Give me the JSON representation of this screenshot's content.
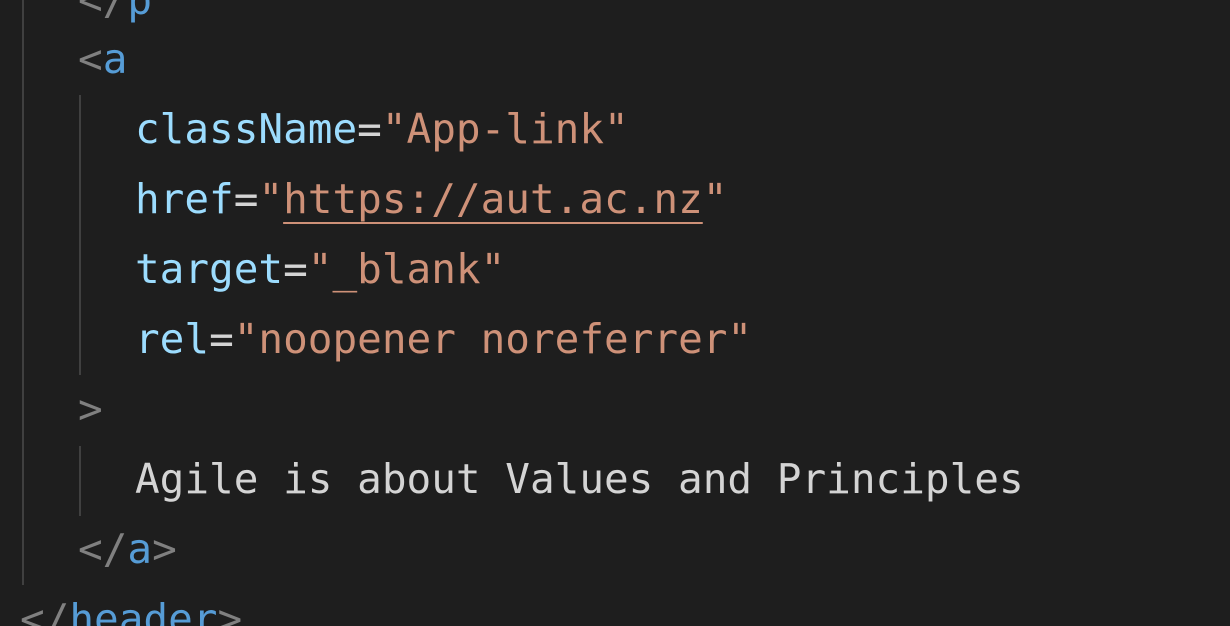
{
  "editor": {
    "lines": {
      "p_close_fragment": {
        "open": "</",
        "tag": "p"
      },
      "a_open": {
        "open": "<",
        "tag": "a"
      },
      "classname": {
        "attr": "className",
        "eq": "=",
        "value": "\"App-link\""
      },
      "href": {
        "attr": "href",
        "eq": "=",
        "quote_open": "\"",
        "url": "https://aut.ac.nz",
        "quote_close": "\""
      },
      "target": {
        "attr": "target",
        "eq": "=",
        "value": "\"_blank\""
      },
      "rel": {
        "attr": "rel",
        "eq": "=",
        "value": "\"noopener noreferrer\""
      },
      "a_open_close": {
        "close": ">"
      },
      "content": {
        "text": "Agile is about Values and Principles"
      },
      "a_close": {
        "open": "</",
        "tag": "a",
        "close": ">"
      },
      "header_close": {
        "open": "</",
        "tag": "header",
        "close": ">"
      }
    },
    "colors": {
      "background": "#1e1e1e",
      "punctuation": "#808080",
      "tag": "#569cd6",
      "attribute": "#9cdcfe",
      "string": "#ce9178",
      "text": "#d4d4d4",
      "indent_guide": "#404040"
    }
  }
}
